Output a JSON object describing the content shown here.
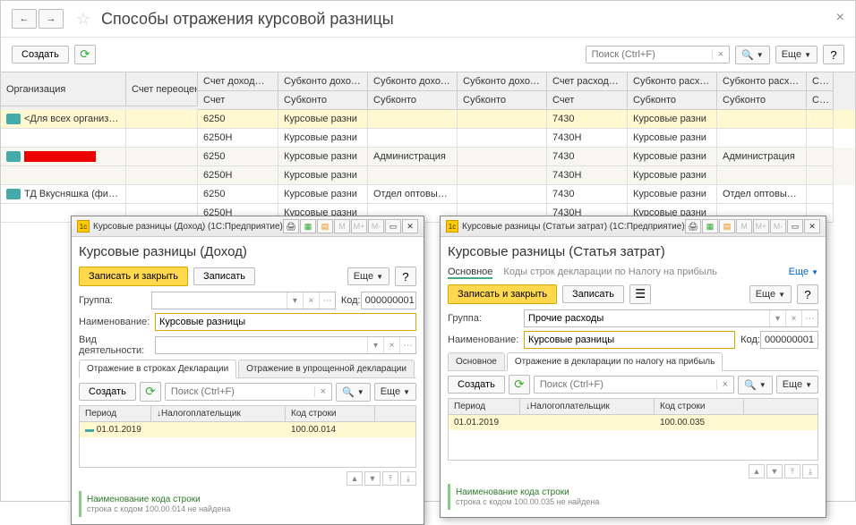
{
  "main": {
    "title": "Способы отражения курсовой разницы",
    "create_btn": "Создать",
    "search_placeholder": "Поиск (Ctrl+F)",
    "more_btn": "Еще"
  },
  "grid": {
    "headers": {
      "org": "Организация",
      "reeval": "Счет переоценки",
      "income_acct": "Счет доход…",
      "income_sub1": "Субконто доход…",
      "income_sub2": "Субконто доход…",
      "income_sub3": "Субконто доход…",
      "expense_acct": "Счет расход…",
      "expense_sub1": "Субконто расход…",
      "expense_sub2": "Субконто расход…",
      "expense_sub3": "Су…"
    },
    "subheaders": {
      "acct": "Счет",
      "sub": "Субконто"
    },
    "rows": [
      {
        "org": "<Для всех организаций>",
        "badge": true,
        "r1": {
          "ia": "6250",
          "is1": "Курсовые разни",
          "ea": "7430",
          "es1": "Курсовые разни"
        },
        "r2": {
          "ia": "6250Н",
          "is1": "Курсовые разни",
          "ea": "7430Н",
          "es1": "Курсовые разни"
        }
      },
      {
        "org": "",
        "redacted": true,
        "badge": true,
        "r1": {
          "ia": "6250",
          "is1": "Курсовые разни",
          "is2": "Администрация",
          "ea": "7430",
          "es1": "Курсовые разни",
          "es2": "Администрация"
        },
        "r2": {
          "ia": "6250Н",
          "is1": "Курсовые разни",
          "ea": "7430Н",
          "es1": "Курсовые разни"
        }
      },
      {
        "org": "ТД Вкусняшка (филиал \"ТД…",
        "badge": true,
        "r1": {
          "ia": "6250",
          "is1": "Курсовые разни",
          "is2": "Отдел оптовых п…",
          "ea": "7430",
          "es1": "Курсовые разни",
          "es2": "Отдел оптовых п…"
        },
        "r2": {
          "ia": "6250Н",
          "is1": "Курсовые разни",
          "ea": "7430Н",
          "es1": "Курсовые разни"
        }
      }
    ]
  },
  "dlg1": {
    "titlebar": "Курсовые разницы (Доход) (1С:Предприятие)",
    "heading": "Курсовые разницы (Доход)",
    "save_close": "Записать и закрыть",
    "save": "Записать",
    "more": "Еще",
    "group_lbl": "Группа:",
    "code_lbl": "Код:",
    "code_val": "000000001",
    "name_lbl": "Наименование:",
    "name_val": "Курсовые разницы",
    "activity_lbl": "Вид деятельности:",
    "tab1": "Отражение в строках Декларации",
    "tab2": "Отражение в упрощенной декларации",
    "create": "Создать",
    "search_ph": "Поиск (Ctrl+F)",
    "col_period": "Период",
    "col_payer": "Налогоплательщик",
    "col_code": "Код строки",
    "period_val": "01.01.2019",
    "code_str": "100.00.014",
    "foot_head": "Наименование кода строки",
    "foot_text": "строка с кодом 100.00.014 не найдена"
  },
  "dlg2": {
    "titlebar": "Курсовые разницы (Статьи затрат) (1С:Предприятие)",
    "heading": "Курсовые разницы (Статья затрат)",
    "nav_main": "Основное",
    "nav_link": "Коды строк декларации по Налогу на прибыль",
    "save_close": "Записать и закрыть",
    "save": "Записать",
    "more": "Еще",
    "group_lbl": "Группа:",
    "group_val": "Прочие расходы",
    "name_lbl": "Наименование:",
    "name_val": "Курсовые разницы",
    "code_lbl": "Код:",
    "code_val": "000000001",
    "tab1": "Основное",
    "tab2": "Отражение в декларации по налогу на прибыль",
    "create": "Создать",
    "search_ph": "Поиск (Ctrl+F)",
    "col_period": "Период",
    "col_payer": "Налогоплательщик",
    "col_code": "Код строки",
    "period_val": "01.01.2019",
    "code_str": "100.00.035",
    "foot_head": "Наименование кода строки",
    "foot_text": "строка с кодом 100.00.035 не найдена"
  }
}
